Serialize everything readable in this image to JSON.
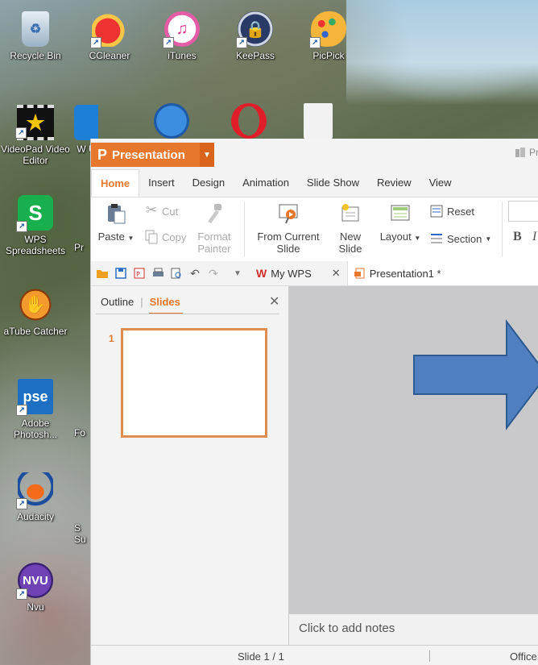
{
  "desktop": {
    "icons": [
      {
        "label": "Recycle Bin"
      },
      {
        "label": "CCleaner"
      },
      {
        "label": "iTunes"
      },
      {
        "label": "KeePass"
      },
      {
        "label": "PicPick"
      },
      {
        "label": "VideoPad Video Editor"
      },
      {
        "label": "W U"
      },
      {
        "label": "WPS Spreadsheets"
      },
      {
        "label": "Pr"
      },
      {
        "label": "aTube Catcher"
      },
      {
        "label": "Adobe Photosh..."
      },
      {
        "label": "Fo"
      },
      {
        "label": "Audacity"
      },
      {
        "label": "S Su"
      },
      {
        "label": "Nvu"
      }
    ]
  },
  "app": {
    "logo_glyph": "P",
    "title": "Presentation",
    "title_right": "Pr",
    "tabs": [
      "Home",
      "Insert",
      "Design",
      "Animation",
      "Slide Show",
      "Review",
      "View"
    ],
    "active_tab": "Home",
    "ribbon": {
      "paste": "Paste",
      "cut": "Cut",
      "copy": "Copy",
      "format_painter": "Format Painter",
      "from_current_slide": "From Current Slide",
      "new_slide": "New Slide",
      "layout": "Layout",
      "reset": "Reset",
      "section": "Section",
      "bold": "B",
      "italic": "I"
    },
    "doc_tabs": {
      "mywps": "My WPS",
      "presentation": "Presentation1 *"
    },
    "panel": {
      "outline": "Outline",
      "slides": "Slides",
      "slide_number": "1"
    },
    "notes_placeholder": "Click to add notes",
    "status": {
      "slide": "Slide 1 / 1",
      "theme": "Office"
    }
  },
  "colors": {
    "accent": "#e8772e",
    "arrow_fill": "#4f7fbf",
    "arrow_stroke": "#2e5a92"
  }
}
